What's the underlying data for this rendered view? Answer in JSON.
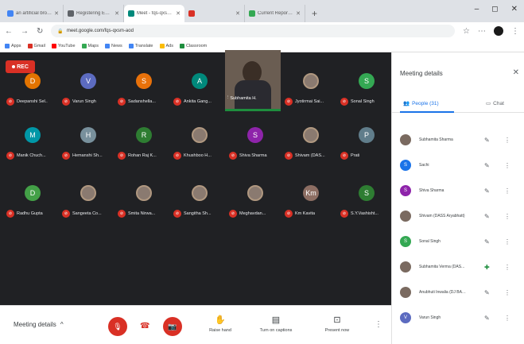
{
  "browser": {
    "tabs": [
      {
        "title": "an artificial bro - Google Search",
        "color": "#4285f4",
        "active": false
      },
      {
        "title": "Registering Ed webinar on Ms...",
        "color": "#5f6368",
        "active": false
      },
      {
        "title": "Meet - fqs-qxsm-aod",
        "color": "#00897b",
        "active": true
      },
      {
        "title": "",
        "color": "#d93025",
        "active": false
      },
      {
        "title": "Current Report 2020 Lev - Googl",
        "color": "#34a853",
        "active": false
      }
    ],
    "newtab": "+",
    "window": {
      "min": "–",
      "max": "◻",
      "close": "✕"
    },
    "url": "meet.google.com/fqs-qxsm-aod",
    "bookmarks": [
      {
        "label": "Apps",
        "color": "#4285f4"
      },
      {
        "label": "Gmail",
        "color": "#d93025"
      },
      {
        "label": "YouTube",
        "color": "#ff0000"
      },
      {
        "label": "Maps",
        "color": "#34a853"
      },
      {
        "label": "News",
        "color": "#4285f4"
      },
      {
        "label": "Translate",
        "color": "#4285f4"
      },
      {
        "label": "Ads",
        "color": "#fbbc04"
      },
      {
        "label": "Classroom",
        "color": "#1e8e3e"
      }
    ]
  },
  "meeting": {
    "rec_label": "REC",
    "presenter": {
      "name": "Subhamita H."
    },
    "participants_grid": [
      {
        "initial": "D",
        "color": "#e37400",
        "name": "Deepanshi Sel.."
      },
      {
        "initial": "V",
        "color": "#5c6bc0",
        "name": "Varun Singh"
      },
      {
        "initial": "S",
        "color": "#e8710a",
        "name": "Sadanshella..."
      },
      {
        "initial": "A",
        "color": "#00897b",
        "name": "Ankita Gang..."
      },
      {
        "initial": "",
        "color": "",
        "name": "Jyotirmai Sai..."
      },
      {
        "initial": "S",
        "color": "#34a853",
        "name": "Sonal Singh"
      },
      {
        "initial": "M",
        "color": "#0097a7",
        "name": "Manik Chuch..."
      },
      {
        "initial": "H",
        "color": "#78909c",
        "name": "Hemanshi Sh..."
      },
      {
        "initial": "R",
        "color": "#2e7d32",
        "name": "Rohan Raj K..."
      },
      {
        "initial": "",
        "color": "",
        "name": "Khushboo H..."
      },
      {
        "initial": "S",
        "color": "#8e24aa",
        "name": "Shiva Sharma"
      },
      {
        "initial": "",
        "color": "",
        "name": "Shivam (DAS..."
      },
      {
        "initial": "P",
        "color": "#607d8b",
        "name": "Prati"
      },
      {
        "initial": "D",
        "color": "#43a047",
        "name": "Radhu Gupta"
      },
      {
        "initial": "",
        "color": "",
        "name": "Sangeeta Co..."
      },
      {
        "initial": "",
        "color": "",
        "name": "Smita Nirwa..."
      },
      {
        "initial": "",
        "color": "",
        "name": "Sangitha Sh..."
      },
      {
        "initial": "",
        "color": "",
        "name": "Meghavdan..."
      },
      {
        "initial": "Km",
        "color": "#8d6e63",
        "name": "Km Kavita"
      },
      {
        "initial": "S",
        "color": "#2e7d32",
        "name": "S.Y.Vashisht..."
      }
    ]
  },
  "bottom_bar": {
    "meeting_details": "Meeting details",
    "mic_icon": "🎙",
    "hangup_icon": "☎",
    "cam_icon": "📷",
    "raise_hand": "Raise hand",
    "turn_on_captions": "Turn on captions",
    "present_now": "Present now",
    "more": "⋮"
  },
  "side_panel": {
    "title": "Meeting details",
    "close": "✕",
    "people_tab": "People (31)",
    "chat_tab": "Chat",
    "people": [
      {
        "initial": "",
        "color": "",
        "name": "Subhamita Sharma",
        "pinned": false
      },
      {
        "initial": "S",
        "color": "#1a73e8",
        "name": "Sachi",
        "pinned": false
      },
      {
        "initial": "S",
        "color": "#8e24aa",
        "name": "Shiva Sharma",
        "pinned": false
      },
      {
        "initial": "",
        "color": "",
        "name": "Shivam (DASS Aryabhatt)",
        "pinned": false
      },
      {
        "initial": "S",
        "color": "#34a853",
        "name": "Sonal Singh",
        "pinned": false
      },
      {
        "initial": "",
        "color": "",
        "name": "Subhamita Verma (DAS...",
        "pinned": true
      },
      {
        "initial": "",
        "color": "",
        "name": "Anubhuti Inwalia (DJ BAS...",
        "pinned": false
      },
      {
        "initial": "V",
        "color": "#5c6bc0",
        "name": "Varun Singh",
        "pinned": false
      }
    ]
  }
}
